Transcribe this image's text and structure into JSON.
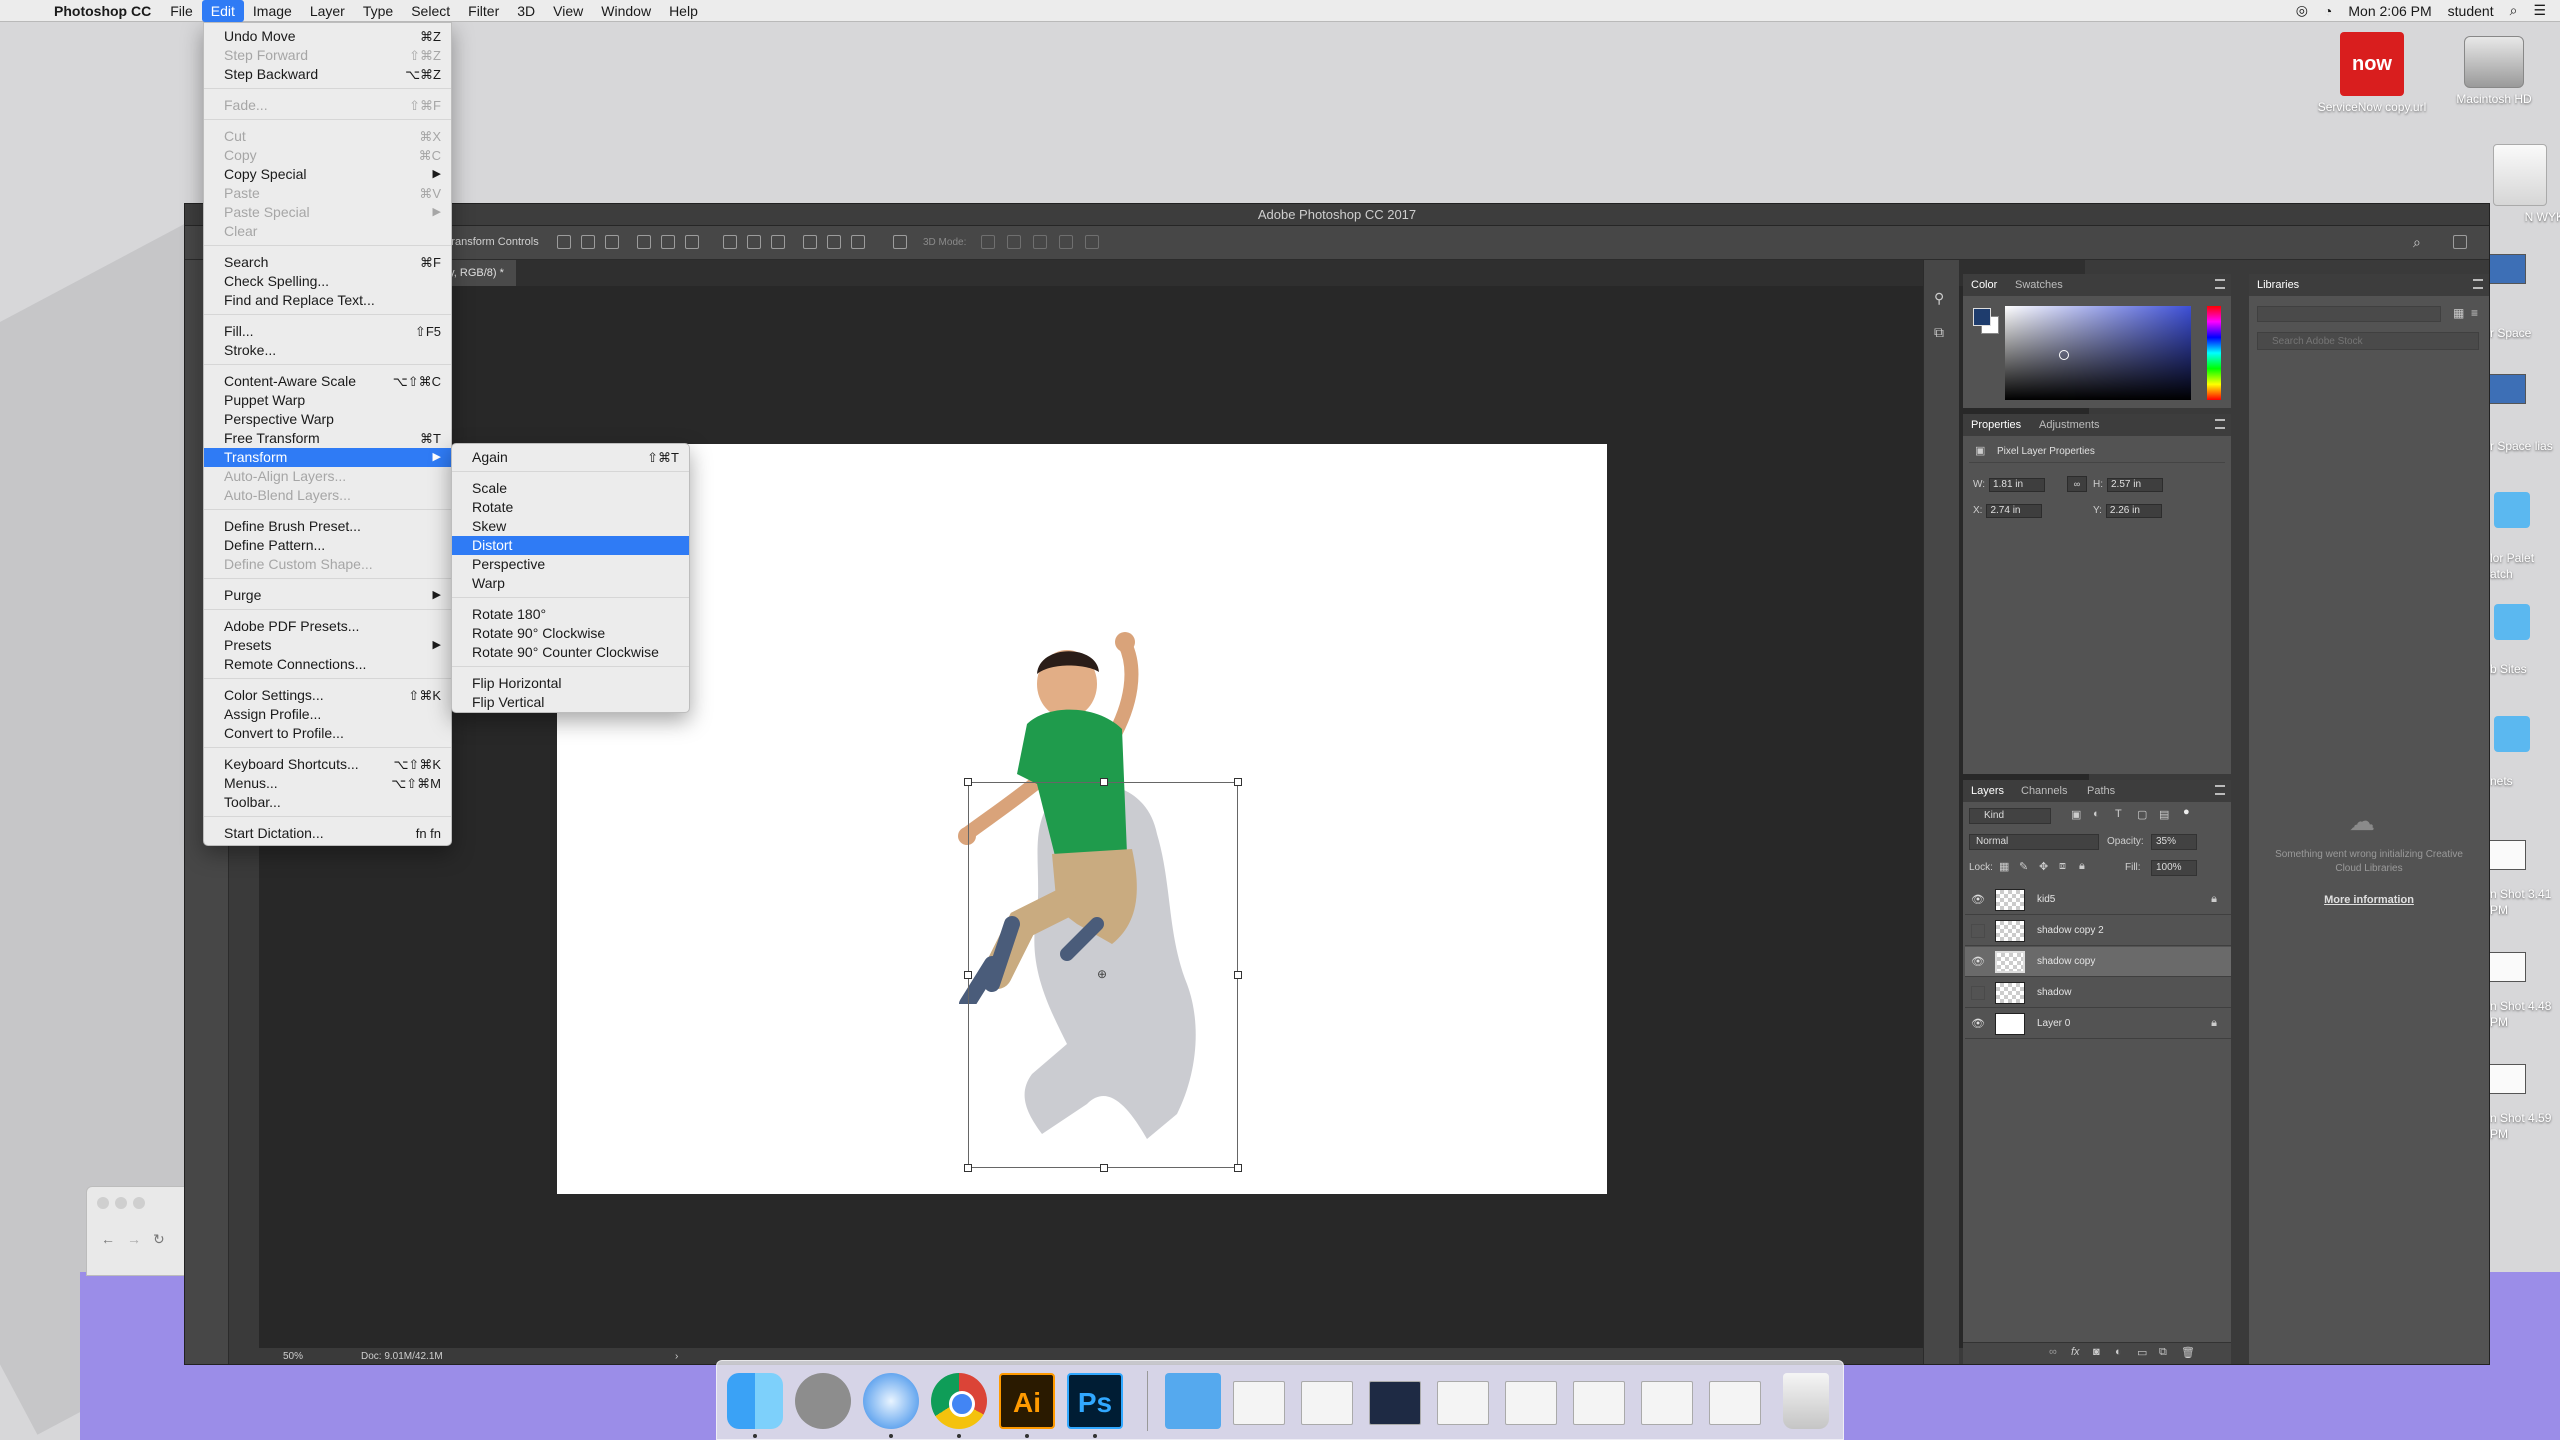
{
  "menubar": {
    "app_name": "Photoshop CC",
    "items": [
      "File",
      "Edit",
      "Image",
      "Layer",
      "Type",
      "Select",
      "Filter",
      "3D",
      "View",
      "Window",
      "Help"
    ],
    "clock": "Mon 2:06 PM",
    "user": "student"
  },
  "desktop": {
    "icons": [
      {
        "label": "ServiceNow copy.url",
        "glyph": "now"
      },
      {
        "label": "Macintosh HD"
      },
      {
        "label": "N WYKE"
      }
    ],
    "right_cut_labels": [
      "r Space",
      "r Space lias",
      "lor Palet atch",
      "b Sites",
      "nets",
      "n Shot 3.41 PM",
      "n Shot 4.48 PM",
      "n Shot 4.59 PM"
    ]
  },
  "photoshop": {
    "window_title": "Adobe Photoshop CC 2017",
    "options_bar": {
      "transform_controls": "Transform Controls",
      "mode_3d": "3D Mode:"
    },
    "doc_tab": "py, RGB/8) *",
    "status": {
      "zoom": "50%",
      "doc": "Doc: 9.01M/42.1M"
    },
    "color_panel": {
      "tabs": [
        "Color",
        "Swatches"
      ],
      "fg_color": "#1e3c6d",
      "bg_color": "#ffffff"
    },
    "libraries_panel": {
      "tab": "Libraries",
      "search_placeholder": "Search Adobe Stock",
      "error": "Something went wrong initializing Creative Cloud Libraries",
      "more_info": "More information"
    },
    "properties_panel": {
      "tabs": [
        "Properties",
        "Adjustments"
      ],
      "heading": "Pixel Layer Properties",
      "w_label": "W:",
      "w": "1.81 in",
      "h_label": "H:",
      "h": "2.57 in",
      "x_label": "X:",
      "x": "2.74 in",
      "y_label": "Y:",
      "y": "2.26 in"
    },
    "layers_panel": {
      "tabs": [
        "Layers",
        "Channels",
        "Paths"
      ],
      "kind": "Kind",
      "blend_mode": "Normal",
      "opacity_label": "Opacity:",
      "opacity": "35%",
      "lock_label": "Lock:",
      "fill_label": "Fill:",
      "fill": "100%",
      "layers": [
        {
          "name": "kid5",
          "visible": true,
          "locked": true,
          "selected": false
        },
        {
          "name": "shadow copy 2",
          "visible": false,
          "locked": false,
          "selected": false
        },
        {
          "name": "shadow copy",
          "visible": true,
          "locked": false,
          "selected": true
        },
        {
          "name": "shadow",
          "visible": false,
          "locked": false,
          "selected": false
        },
        {
          "name": "Layer 0",
          "visible": true,
          "locked": true,
          "selected": false
        }
      ]
    }
  },
  "edit_menu": [
    {
      "label": "Undo Move",
      "shortcut": "⌘Z"
    },
    {
      "label": "Step Forward",
      "shortcut": "⇧⌘Z",
      "disabled": true
    },
    {
      "label": "Step Backward",
      "shortcut": "⌥⌘Z"
    },
    {
      "sep": true
    },
    {
      "label": "Fade...",
      "shortcut": "⇧⌘F",
      "disabled": true
    },
    {
      "sep": true
    },
    {
      "label": "Cut",
      "shortcut": "⌘X",
      "disabled": true
    },
    {
      "label": "Copy",
      "shortcut": "⌘C",
      "disabled": true
    },
    {
      "label": "Copy Special",
      "submenu": true
    },
    {
      "label": "Paste",
      "shortcut": "⌘V",
      "disabled": true
    },
    {
      "label": "Paste Special",
      "submenu": true,
      "disabled": true
    },
    {
      "label": "Clear",
      "disabled": true
    },
    {
      "sep": true
    },
    {
      "label": "Search",
      "shortcut": "⌘F"
    },
    {
      "label": "Check Spelling..."
    },
    {
      "label": "Find and Replace Text..."
    },
    {
      "sep": true
    },
    {
      "label": "Fill...",
      "shortcut": "⇧F5"
    },
    {
      "label": "Stroke..."
    },
    {
      "sep": true
    },
    {
      "label": "Content-Aware Scale",
      "shortcut": "⌥⇧⌘C"
    },
    {
      "label": "Puppet Warp"
    },
    {
      "label": "Perspective Warp"
    },
    {
      "label": "Free Transform",
      "shortcut": "⌘T"
    },
    {
      "label": "Transform",
      "submenu": true,
      "highlighted": true
    },
    {
      "label": "Auto-Align Layers...",
      "disabled": true
    },
    {
      "label": "Auto-Blend Layers...",
      "disabled": true
    },
    {
      "sep": true
    },
    {
      "label": "Define Brush Preset..."
    },
    {
      "label": "Define Pattern..."
    },
    {
      "label": "Define Custom Shape...",
      "disabled": true
    },
    {
      "sep": true
    },
    {
      "label": "Purge",
      "submenu": true
    },
    {
      "sep": true
    },
    {
      "label": "Adobe PDF Presets..."
    },
    {
      "label": "Presets",
      "submenu": true
    },
    {
      "label": "Remote Connections..."
    },
    {
      "sep": true
    },
    {
      "label": "Color Settings...",
      "shortcut": "⇧⌘K"
    },
    {
      "label": "Assign Profile..."
    },
    {
      "label": "Convert to Profile..."
    },
    {
      "sep": true
    },
    {
      "label": "Keyboard Shortcuts...",
      "shortcut": "⌥⇧⌘K"
    },
    {
      "label": "Menus...",
      "shortcut": "⌥⇧⌘M"
    },
    {
      "label": "Toolbar..."
    },
    {
      "sep": true
    },
    {
      "label": "Start Dictation...",
      "shortcut": "fn fn"
    }
  ],
  "transform_submenu": [
    {
      "label": "Again",
      "shortcut": "⇧⌘T"
    },
    {
      "sep": true
    },
    {
      "label": "Scale"
    },
    {
      "label": "Rotate"
    },
    {
      "label": "Skew"
    },
    {
      "label": "Distort",
      "highlighted": true
    },
    {
      "label": "Perspective"
    },
    {
      "label": "Warp"
    },
    {
      "sep": true
    },
    {
      "label": "Rotate 180°"
    },
    {
      "label": "Rotate 90° Clockwise"
    },
    {
      "label": "Rotate 90° Counter Clockwise"
    },
    {
      "sep": true
    },
    {
      "label": "Flip Horizontal"
    },
    {
      "label": "Flip Vertical"
    }
  ],
  "dock": {
    "apps": [
      "Finder",
      "Launchpad",
      "Safari",
      "Chrome",
      "Illustrator",
      "Photoshop"
    ],
    "ai_label": "Ai",
    "ps_label": "Ps"
  }
}
